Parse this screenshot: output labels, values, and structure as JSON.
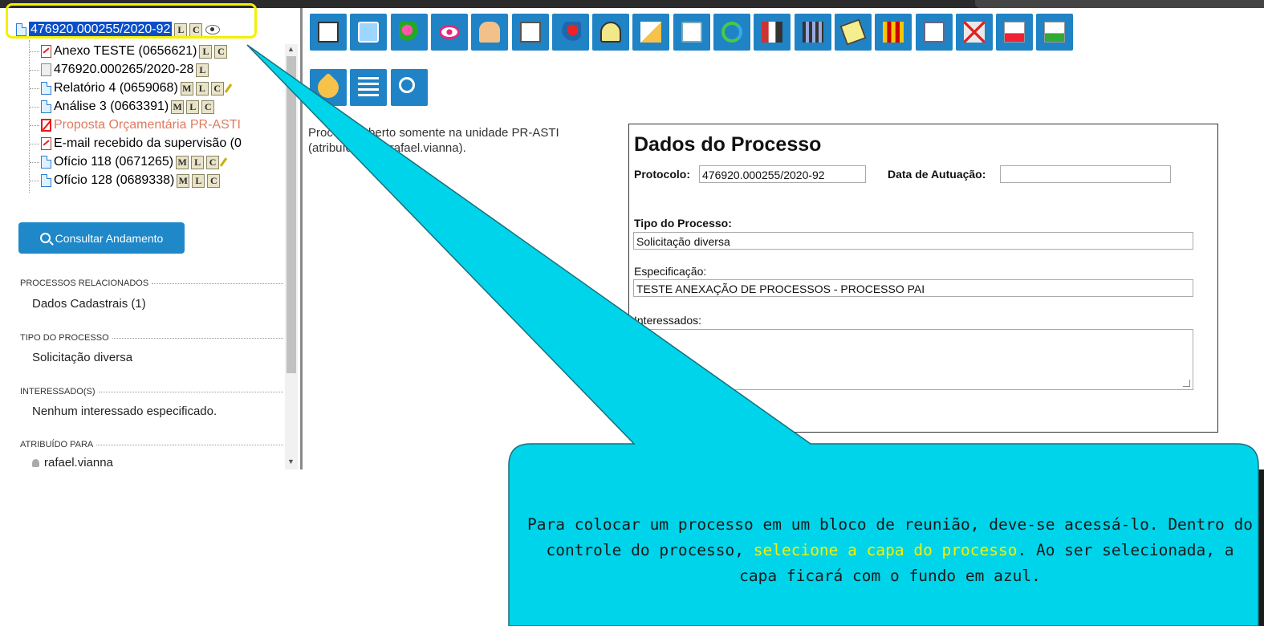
{
  "tree": {
    "root": {
      "label": "476920.000255/2020-92",
      "badges": [
        "L",
        "C"
      ]
    },
    "items": [
      {
        "label": "Anexo TESTE (0656621)",
        "badges": [
          "L",
          "C"
        ],
        "icon": "pdf-icon"
      },
      {
        "label": "476920.000265/2020-28",
        "badges": [
          "L"
        ],
        "icon": "process-icon"
      },
      {
        "label": "Relatório 4 (0659068)",
        "badges": [
          "M",
          "L",
          "C"
        ],
        "icon": "document-icon"
      },
      {
        "label": "Análise 3 (0663391)",
        "badges": [
          "M",
          "L",
          "C"
        ],
        "icon": "document-icon"
      },
      {
        "label": "Proposta Orçamentária PR-ASTI",
        "badges": [],
        "icon": "cancelled-document-icon"
      },
      {
        "label": "E-mail recebido da supervisão (0",
        "badges": [],
        "icon": "pdf-icon"
      },
      {
        "label": "Ofício 118 (0671265)",
        "badges": [
          "M",
          "L",
          "C"
        ],
        "icon": "document-icon"
      },
      {
        "label": "Ofício 128 (0689338)",
        "badges": [
          "M",
          "L",
          "C"
        ],
        "icon": "document-icon"
      }
    ]
  },
  "consult_button": "Consultar Andamento",
  "sections": [
    {
      "title": "PROCESSOS RELACIONADOS",
      "value": "Dados Cadastrais (1)"
    },
    {
      "title": "TIPO DO PROCESSO",
      "value": "Solicitação diversa"
    },
    {
      "title": "INTERESSADO(S)",
      "value": "Nenhum interessado especificado."
    },
    {
      "title": "ATRIBUÍDO PARA",
      "value": "rafael.vianna"
    }
  ],
  "toolbar_icons": [
    "new-document-icon",
    "start-process-icon",
    "assign-icon",
    "view-icon",
    "approve-icon",
    "send-email-icon",
    "send-process-icon",
    "assign-user-icon",
    "relate-icon",
    "email-icon",
    "update-icon",
    "archive-icon",
    "building-icon",
    "notes-icon",
    "pause-icon",
    "edit-icon",
    "cancel-icon",
    "pdf-icon",
    "zip-icon",
    "tag-icon",
    "list-icon",
    "search-icon"
  ],
  "message": {
    "line1": "Processo aberto somente na unidade PR-ASTI",
    "line2": "(atribuído para rafael.vianna)."
  },
  "dados": {
    "title": "Dados do Processo",
    "protocolo_label": "Protocolo:",
    "protocolo_value": "476920.000255/2020-92",
    "data_label": "Data de Autuação:",
    "data_value": "",
    "tipo_label": "Tipo do Processo:",
    "tipo_value": "Solicitação diversa",
    "espec_label": "Especificação:",
    "espec_value": "TESTE ANEXAÇÃO DE PROCESSOS - PROCESSO PAI",
    "interessados_label": "Interessados:"
  },
  "callout": {
    "text_before": "Para colocar um processo em um bloco de reunião, deve-se acessá-lo. Dentro do controle do processo, ",
    "text_highlight": "selecione a capa do processo",
    "text_after": ". Ao ser selecionada, a capa ficará com o fundo em azul.",
    "fill_color": "#00d4ea",
    "highlight_color": "#f6f000"
  },
  "colors": {
    "toolbar": "#1f83c5",
    "selection": "#0a4fc9",
    "button": "#1e88c9"
  }
}
